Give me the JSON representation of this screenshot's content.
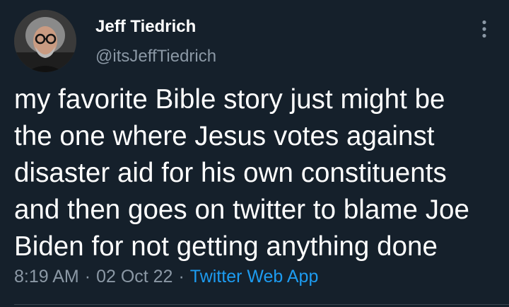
{
  "author": {
    "display_name": "Jeff Tiedrich",
    "handle": "@itsJeffTiedrich",
    "avatar_icon": "profile-photo"
  },
  "tweet": {
    "text": "my favorite Bible story just might be\nthe one where Jesus votes against\ndisaster aid for his own constituents\nand then goes on twitter to blame Joe\nBiden for not getting anything done",
    "time": "8:19 AM",
    "date": "02 Oct 22",
    "separator": "·",
    "source": "Twitter Web App"
  },
  "menu": {
    "icon": "more-vertical-icon"
  },
  "colors": {
    "background": "#15202b",
    "primary_text": "#ffffff",
    "secondary_text": "#8b98a5",
    "accent": "#1d9bf0",
    "divider": "#38444d"
  }
}
